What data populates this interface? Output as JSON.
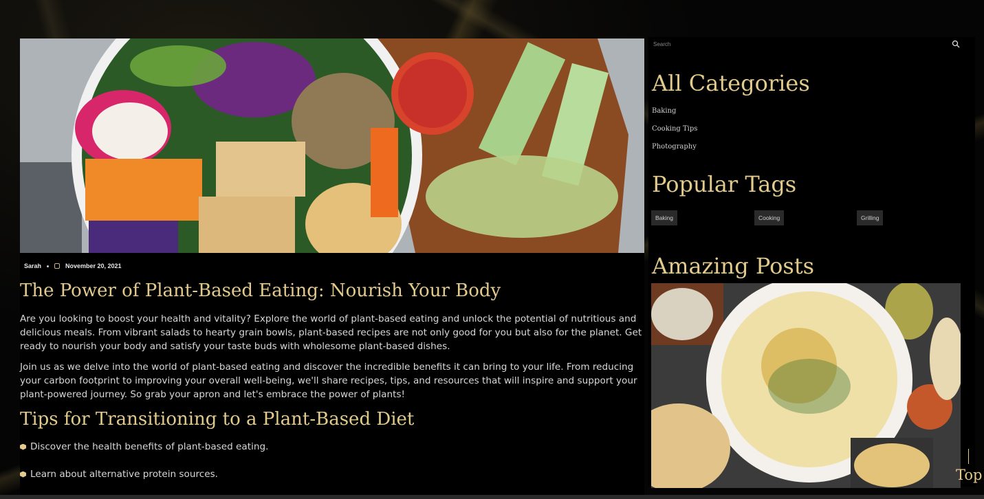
{
  "post": {
    "author": "Sarah",
    "date": "November 20, 2021",
    "title": "The Power of Plant-Based Eating: Nourish Your Body",
    "paragraphs": [
      "Are you looking to boost your health and vitality? Explore the world of plant-based eating and unlock the potential of nutritious and delicious meals. From vibrant salads to hearty grain bowls, plant-based recipes are not only good for you but also for the planet. Get ready to nourish your body and satisfy your taste buds with wholesome plant-based dishes.",
      "Join us as we delve into the world of plant-based eating and discover the incredible benefits it can bring to your life. From reducing your carbon footprint to improving your overall well-being, we'll share recipes, tips, and resources that will inspire and support your plant-powered journey. So grab your apron and let's embrace the power of plants!"
    ],
    "subheading": "Tips for Transitioning to a Plant-Based Diet",
    "tips": [
      "Discover the health benefits of plant-based eating.",
      "Learn about alternative protein sources."
    ]
  },
  "sidebar": {
    "search_placeholder": "Search",
    "categories_title": "All Categories",
    "categories": [
      "Baking",
      "Cooking Tips",
      "Photography"
    ],
    "tags_title": "Popular Tags",
    "tags": [
      "Baking",
      "Cooking",
      "Grilling"
    ],
    "posts_title": "Amazing Posts"
  },
  "top_button": "Top",
  "colors": {
    "accent": "#e2c98c",
    "background": "#000000",
    "text": "#d7d7d7"
  }
}
